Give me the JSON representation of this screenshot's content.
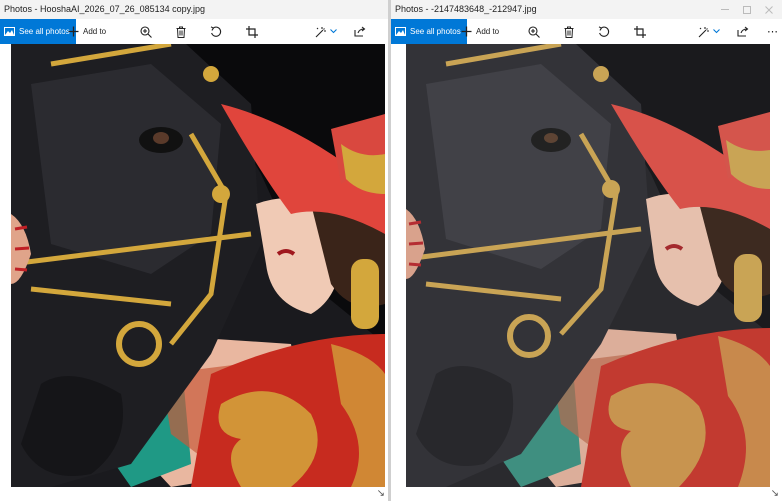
{
  "windows": [
    {
      "title": "Photos - HooshaAI_2026_07_26_085134 copy.jpg",
      "toolbar": {
        "see_all": "See all photos",
        "add_to": "Add to",
        "more": ""
      },
      "photo_alt": "Black horse with woman in red hat"
    },
    {
      "title": "Photos - -2147483648_-212947.jpg",
      "toolbar": {
        "see_all": "See all photos",
        "add_to": "Add to",
        "more": "⋯"
      },
      "photo_alt": "Black horse with woman in red hat (softer copy)"
    }
  ],
  "colors": {
    "accent": "#0078d7",
    "hat": "#e0453c",
    "horse": "#1c1c1f",
    "gold": "#d3a73c"
  }
}
